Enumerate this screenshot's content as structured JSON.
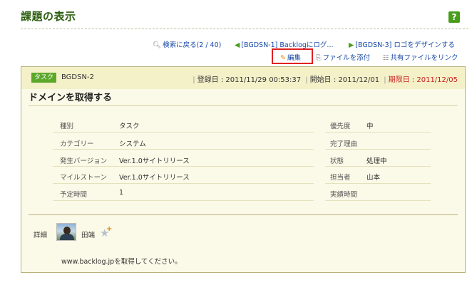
{
  "page": {
    "title": "課題の表示",
    "help_label": "?"
  },
  "nav": {
    "back_search": "検索に戻る(2 / 40)",
    "prev_issue": "[BGDSN-1] Backlogにログ...",
    "next_issue": "[BGDSN-3] ロゴをデザインする"
  },
  "actions": {
    "edit": "編集",
    "attach_file": "ファイルを添付",
    "link_shared_file": "共有ファイルをリンク"
  },
  "issue": {
    "type": "タスク",
    "key": "BGDSN-2",
    "registered": "登録日 : 2011/11/29 00:53:37",
    "start_date": "開始日 : 2011/12/01",
    "due_date": "期限日 : 2011/12/05",
    "summary": "ドメインを取得する"
  },
  "properties_left": [
    {
      "label": "種別",
      "value": "タスク"
    },
    {
      "label": "カテゴリー",
      "value": "システム"
    },
    {
      "label": "発生バージョン",
      "value": "Ver.1.0サイトリリース"
    },
    {
      "label": "マイルストーン",
      "value": "Ver.1.0サイトリリース"
    },
    {
      "label": "予定時間",
      "value": "1"
    }
  ],
  "properties_right": [
    {
      "label": "優先度",
      "value": "中"
    },
    {
      "label": "完了理由",
      "value": ""
    },
    {
      "label": "状態",
      "value": "処理中"
    },
    {
      "label": "担当者",
      "value": "山本"
    },
    {
      "label": "実績時間",
      "value": ""
    }
  ],
  "detail": {
    "label": "詳細",
    "author": "田端",
    "description": "www.backlog.jpを取得してください。"
  },
  "colors": {
    "accent_green": "#4a9d1b",
    "title_green": "#2b5e0e",
    "link_blue": "#1a4aa6",
    "due_red": "#c81e1e",
    "panel_bg": "#fbf9e7",
    "highlight_red": "#e02020"
  }
}
